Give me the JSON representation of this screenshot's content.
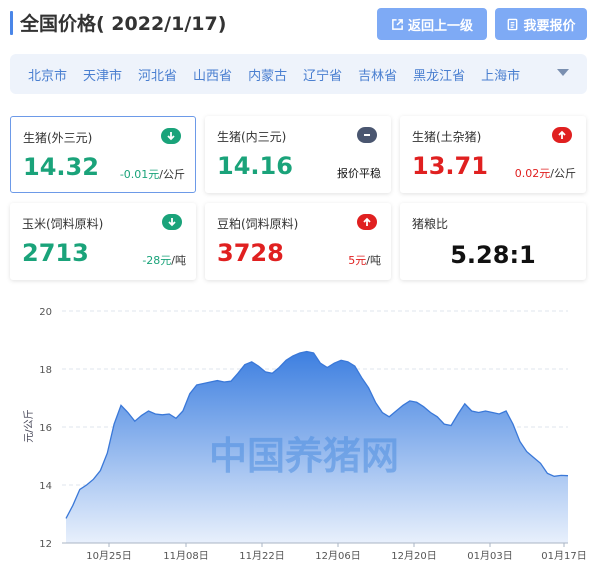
{
  "header": {
    "title": "全国价格( 2022/1/17)",
    "back_button": "返回上一级",
    "quote_button": "我要报价"
  },
  "regions": [
    "北京市",
    "天津市",
    "河北省",
    "山西省",
    "内蒙古",
    "辽宁省",
    "吉林省",
    "黑龙江省",
    "上海市"
  ],
  "cards": [
    {
      "label": "生猪(外三元)",
      "value": "14.32",
      "change": "-0.01元",
      "unit": "/公斤",
      "trend": "down",
      "color": "green",
      "selected": true
    },
    {
      "label": "生猪(内三元)",
      "value": "14.16",
      "change": "报价平稳",
      "unit": "",
      "trend": "flat",
      "color": "green",
      "selected": false
    },
    {
      "label": "生猪(土杂猪)",
      "value": "13.71",
      "change": "0.02元",
      "unit": "/公斤",
      "trend": "up",
      "color": "red",
      "selected": false
    },
    {
      "label": "玉米(饲料原料)",
      "value": "2713",
      "change": "-28元",
      "unit": "/吨",
      "trend": "down",
      "color": "green",
      "selected": false
    },
    {
      "label": "豆粕(饲料原料)",
      "value": "3728",
      "change": "5元",
      "unit": "/吨",
      "trend": "up",
      "color": "red",
      "selected": false
    },
    {
      "label": "猪粮比",
      "value": "5.28:1",
      "change": "",
      "unit": "",
      "trend": "none",
      "color": "black",
      "selected": false
    }
  ],
  "colors": {
    "green": "#1aa37a",
    "red": "#e02020",
    "accent": "#4a86e8",
    "area_top": "#3d7fe0",
    "area_bottom": "#e8f0fc"
  },
  "chart_data": {
    "type": "area",
    "ylabel": "元/公斤",
    "ylim": [
      12,
      20
    ],
    "yticks": [
      12,
      14,
      16,
      18,
      20
    ],
    "xticks": [
      "10月25日",
      "11月08日",
      "11月22日",
      "12月06日",
      "12月20日",
      "01月03日",
      "01月17日"
    ],
    "grid": "horizontal dashed",
    "watermark": "中国养猪网",
    "x": [
      "10/18",
      "10/19",
      "10/20",
      "10/21",
      "10/22",
      "10/23",
      "10/24",
      "10/25",
      "10/26",
      "10/27",
      "10/28",
      "10/29",
      "10/30",
      "10/31",
      "11/01",
      "11/02",
      "11/03",
      "11/04",
      "11/05",
      "11/06",
      "11/07",
      "11/08",
      "11/09",
      "11/10",
      "11/11",
      "11/12",
      "11/13",
      "11/14",
      "11/15",
      "11/16",
      "11/17",
      "11/18",
      "11/19",
      "11/20",
      "11/21",
      "11/22",
      "11/23",
      "11/24",
      "11/25",
      "11/26",
      "11/27",
      "11/28",
      "11/29",
      "11/30",
      "12/01",
      "12/02",
      "12/03",
      "12/04",
      "12/05",
      "12/06",
      "12/07",
      "12/08",
      "12/09",
      "12/10",
      "12/11",
      "12/12",
      "12/13",
      "12/14",
      "12/15",
      "12/16",
      "12/17",
      "12/18",
      "12/19",
      "12/20",
      "12/21",
      "12/22",
      "12/23",
      "12/24",
      "12/25",
      "12/26",
      "12/27",
      "12/28",
      "12/29",
      "12/30",
      "12/31",
      "01/01",
      "01/02",
      "01/03",
      "01/04",
      "01/05",
      "01/06",
      "01/07",
      "01/08",
      "01/09",
      "01/10",
      "01/11",
      "01/12",
      "01/13",
      "01/14",
      "01/15",
      "01/16",
      "01/17"
    ],
    "values": [
      12.85,
      13.3,
      13.85,
      14.0,
      14.2,
      14.5,
      15.1,
      16.1,
      16.75,
      16.5,
      16.2,
      16.4,
      16.55,
      16.45,
      16.42,
      16.45,
      16.3,
      16.55,
      17.15,
      17.45,
      17.5,
      17.55,
      17.6,
      17.55,
      17.58,
      17.85,
      18.15,
      18.25,
      18.1,
      17.9,
      17.85,
      18.05,
      18.3,
      18.45,
      18.55,
      18.6,
      18.55,
      18.2,
      18.05,
      18.2,
      18.3,
      18.25,
      18.1,
      17.7,
      17.35,
      16.85,
      16.5,
      16.35,
      16.55,
      16.75,
      16.9,
      16.85,
      16.7,
      16.5,
      16.35,
      16.1,
      16.05,
      16.45,
      16.8,
      16.55,
      16.5,
      16.55,
      16.5,
      16.45,
      16.55,
      16.1,
      15.5,
      15.15,
      14.95,
      14.75,
      14.4,
      14.3,
      14.33,
      14.32
    ]
  }
}
